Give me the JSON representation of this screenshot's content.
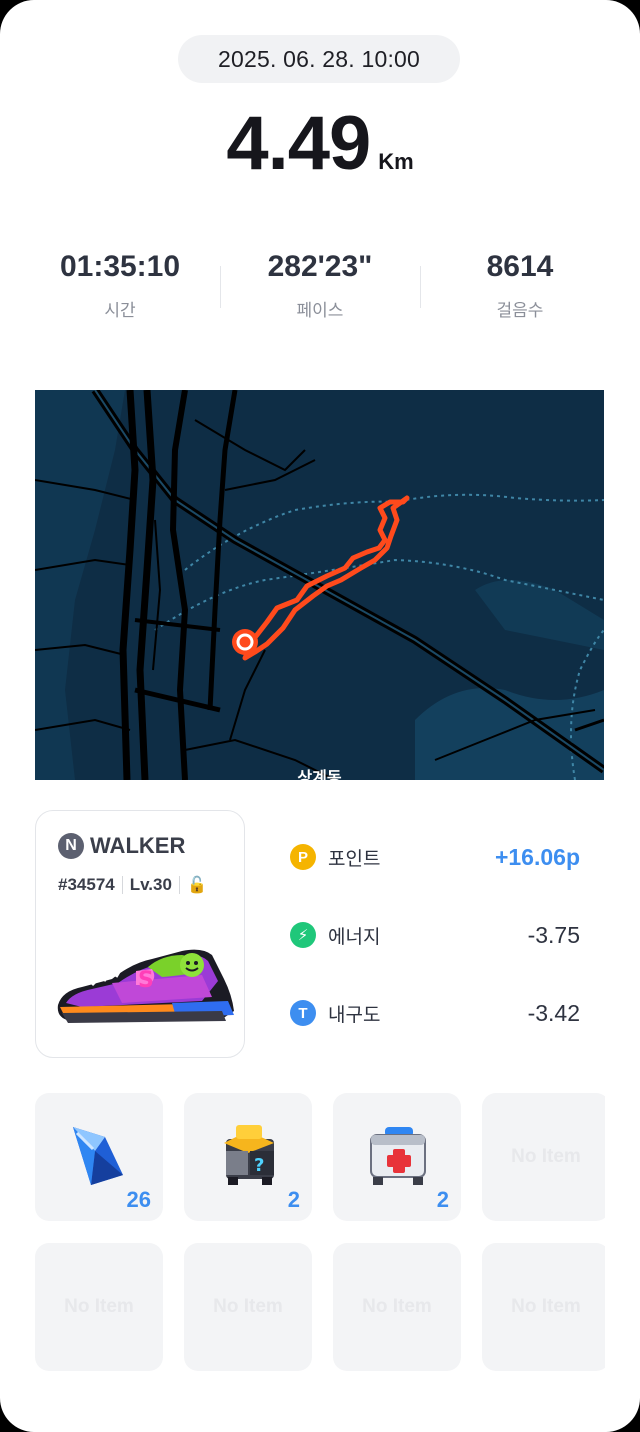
{
  "header": {
    "datetime": "2025. 06. 28. 10:00",
    "distance": "4.49",
    "distance_unit": "Km"
  },
  "stats": [
    {
      "value": "01:35:10",
      "label": "시간"
    },
    {
      "value": "282'23\"",
      "label": "페이스"
    },
    {
      "value": "8614",
      "label": "걸음수"
    }
  ],
  "map": {
    "place_label": "상계동",
    "colors": {
      "background": "#0e2d45",
      "route": "#ff4a1c",
      "road": "#000000"
    }
  },
  "nft": {
    "brand_badge": "N",
    "brand": "WALKER",
    "id": "#34574",
    "level": "Lv.30",
    "lock_icon": "lock-icon"
  },
  "rewards": [
    {
      "icon": "point-icon",
      "icon_glyph": "P",
      "color": "#f5b400",
      "name": "포인트",
      "amount": "+16.06p"
    },
    {
      "icon": "energy-icon",
      "icon_glyph": "⚡",
      "color": "#1fc77a",
      "name": "에너지",
      "amount": "-3.75"
    },
    {
      "icon": "durability-icon",
      "icon_glyph": "T",
      "color": "#3d8ef0",
      "name": "내구도",
      "amount": "-3.42"
    }
  ],
  "items": [
    {
      "icon": "blue-gem-icon",
      "count": "26"
    },
    {
      "icon": "mystery-box-icon",
      "count": "2"
    },
    {
      "icon": "first-aid-kit-icon",
      "count": "2"
    },
    {
      "empty_label": "No Item"
    },
    {
      "empty_label": "No Item"
    },
    {
      "empty_label": "No Item"
    },
    {
      "empty_label": "No Item"
    },
    {
      "empty_label": "No Item"
    }
  ]
}
